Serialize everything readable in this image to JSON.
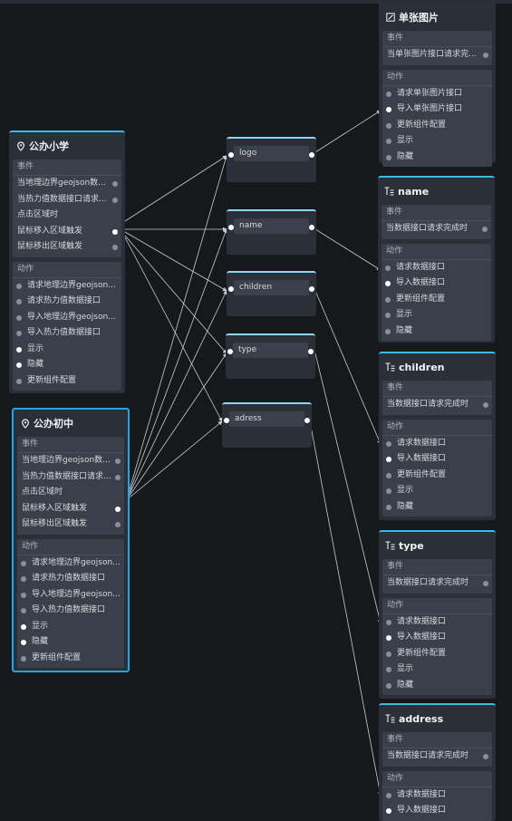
{
  "sections": {
    "events": "事件",
    "actions": "动作"
  },
  "school_primary": {
    "title": "公办小学",
    "events": [
      "当地理边界geojson数...",
      "当热力值数据接口请求...",
      "点击区域时",
      "鼠标移入区域触发",
      "鼠标移出区域触发"
    ],
    "actions": [
      "请求地理边界geojson...",
      "请求热力值数据接口",
      "导入地理边界geojson...",
      "导入热力值数据接口",
      "显示",
      "隐藏",
      "更新组件配置"
    ]
  },
  "school_junior": {
    "title": "公办初中",
    "events": [
      "当地理边界geojson数...",
      "当热力值数据接口请求...",
      "点击区域时",
      "鼠标移入区域触发",
      "鼠标移出区域触发"
    ],
    "actions": [
      "请求地理边界geojson...",
      "请求热力值数据接口",
      "导入地理边界geojson...",
      "导入热力值数据接口",
      "显示",
      "隐藏",
      "更新组件配置"
    ]
  },
  "fields": {
    "logo": "logo",
    "name": "name",
    "children": "children",
    "type": "type",
    "adress": "adress"
  },
  "image_node": {
    "title": "单张图片",
    "events": [
      "当单张图片接口请求完..."
    ],
    "actions": [
      "请求单张图片接口",
      "导入单张图片接口",
      "更新组件配置",
      "显示",
      "隐藏"
    ]
  },
  "text_name": {
    "title": "name",
    "events": [
      "当数据接口请求完成时"
    ],
    "actions": [
      "请求数据接口",
      "导入数据接口",
      "更新组件配置",
      "显示",
      "隐藏"
    ]
  },
  "text_children": {
    "title": "children",
    "events": [
      "当数据接口请求完成时"
    ],
    "actions": [
      "请求数据接口",
      "导入数据接口",
      "更新组件配置",
      "显示",
      "隐藏"
    ]
  },
  "text_type": {
    "title": "type",
    "events": [
      "当数据接口请求完成时"
    ],
    "actions": [
      "请求数据接口",
      "导入数据接口",
      "更新组件配置",
      "显示",
      "隐藏"
    ]
  },
  "text_address": {
    "title": "address",
    "events": [
      "当数据接口请求完成时"
    ],
    "actions": [
      "请求数据接口",
      "导入数据接口"
    ]
  },
  "colors": {
    "accent": "#3ab8e8",
    "selected_border": "#1ea7e6",
    "canvas": "#17181c",
    "node": "#2b3038",
    "wire": "#c8ccd2"
  },
  "icons": {
    "map_node": "location-pin-icon",
    "image_node": "image-edit-icon",
    "text_node": "text-icon"
  }
}
